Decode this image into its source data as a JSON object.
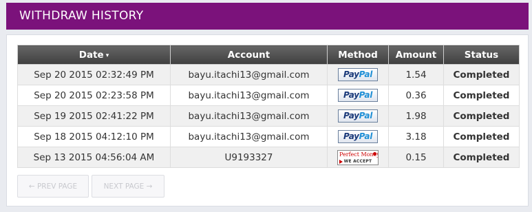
{
  "header": {
    "title": "WITHDRAW HISTORY"
  },
  "table": {
    "columns": [
      {
        "label": "Date",
        "sort_icon": "▾"
      },
      {
        "label": "Account"
      },
      {
        "label": "Method"
      },
      {
        "label": "Amount"
      },
      {
        "label": "Status"
      }
    ],
    "rows": [
      {
        "date": "Sep 20 2015 02:32:49 PM",
        "account": "bayu.itachi13@gmail.com",
        "method": "PayPal",
        "amount": "1.54",
        "status": "Completed"
      },
      {
        "date": "Sep 20 2015 02:23:58 PM",
        "account": "bayu.itachi13@gmail.com",
        "method": "PayPal",
        "amount": "0.36",
        "status": "Completed"
      },
      {
        "date": "Sep 19 2015 02:41:22 PM",
        "account": "bayu.itachi13@gmail.com",
        "method": "PayPal",
        "amount": "1.98",
        "status": "Completed"
      },
      {
        "date": "Sep 18 2015 04:12:10 PM",
        "account": "bayu.itachi13@gmail.com",
        "method": "PayPal",
        "amount": "3.18",
        "status": "Completed"
      },
      {
        "date": "Sep 13 2015 04:56:04 AM",
        "account": "U9193327",
        "method": "Perfect Money",
        "amount": "0.15",
        "status": "Completed"
      }
    ]
  },
  "logos": {
    "paypal": {
      "part1": "Pay",
      "part2": "Pal"
    },
    "perfect_money": {
      "top": "Perfect Money",
      "bottom": "WE ACCEPT"
    }
  },
  "pager": {
    "prev_label": "← PREV PAGE",
    "next_label": "NEXT PAGE →"
  },
  "colors": {
    "header_bg": "#7b127b",
    "status_completed": "#1d6b1d",
    "table_header_bg": "#4a4a4a"
  }
}
